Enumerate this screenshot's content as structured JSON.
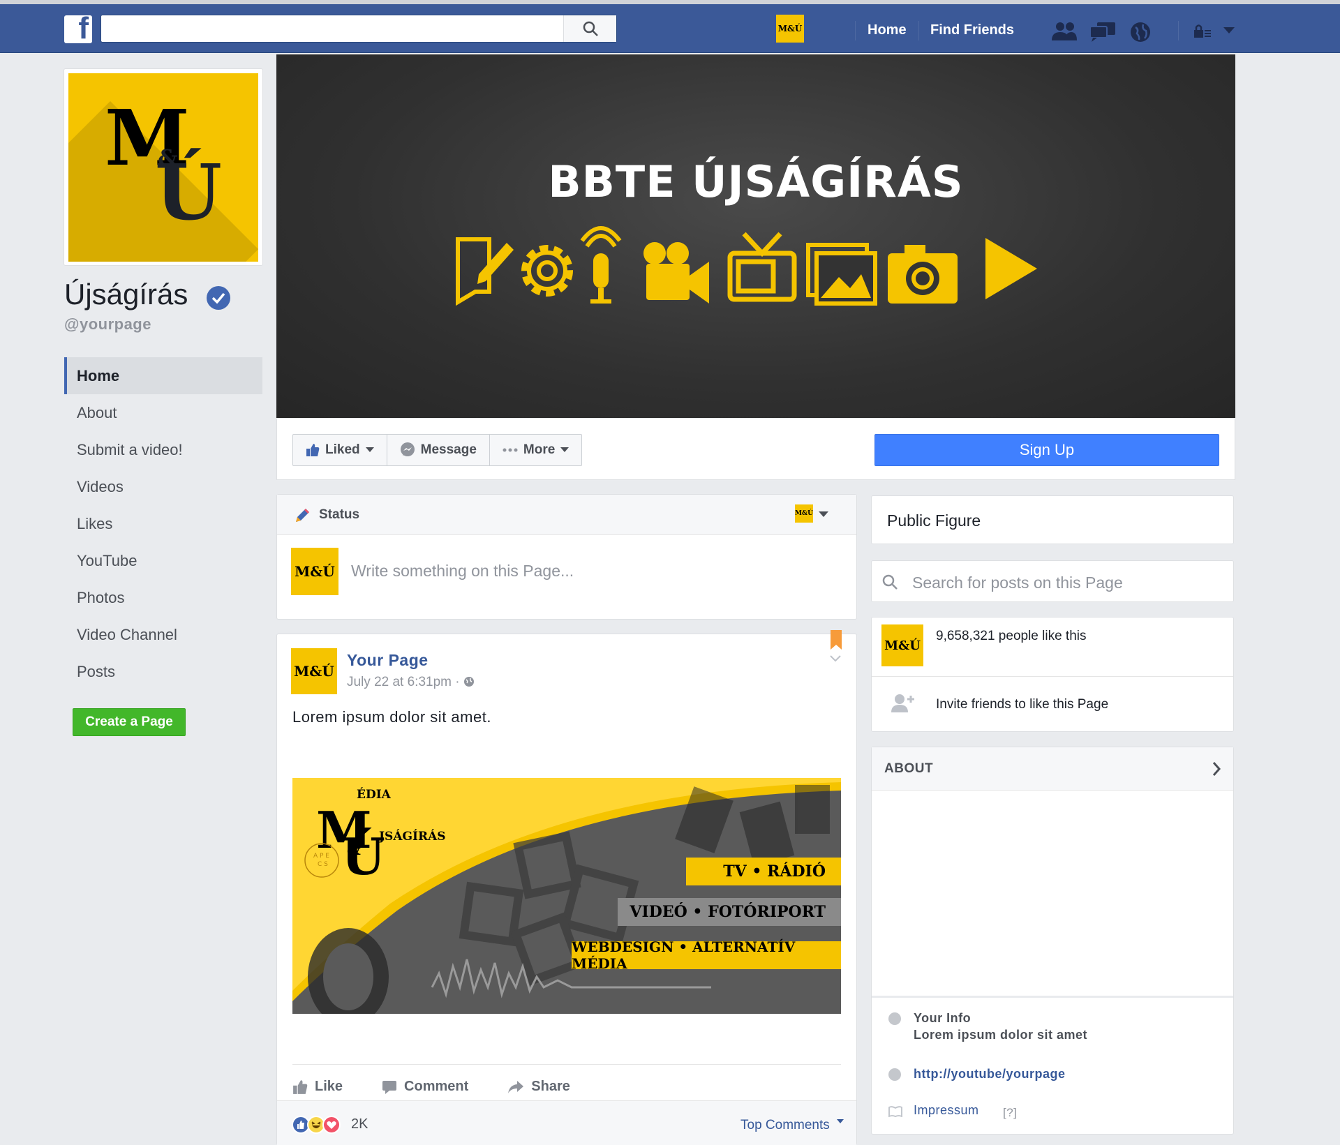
{
  "topbar": {
    "search_placeholder": "",
    "nav_home": "Home",
    "nav_find_friends": "Find Friends",
    "logo_letter": "f",
    "mini_logo_text": "M&Ú"
  },
  "left": {
    "page_name": "Újságírás",
    "handle": "@yourpage",
    "nav_items": [
      {
        "label": "Home",
        "active": true
      },
      {
        "label": "About"
      },
      {
        "label": "Submit a video!"
      },
      {
        "label": "Videos"
      },
      {
        "label": "Likes"
      },
      {
        "label": "YouTube"
      },
      {
        "label": "Photos"
      },
      {
        "label": "Video Channel"
      },
      {
        "label": "Posts"
      }
    ],
    "create_page_label": "Create a Page"
  },
  "cover": {
    "title": "BBTE ÚJSÁGÍRÁS",
    "icon_names": [
      "document-pencil-icon",
      "gear-icon",
      "microphone-icon",
      "video-camera-icon",
      "tv-icon",
      "gallery-icon",
      "photo-camera-icon",
      "play-icon"
    ],
    "accent": "#f5c400"
  },
  "actions": {
    "liked": "Liked",
    "message": "Message",
    "more": "More",
    "signup": "Sign Up"
  },
  "composer": {
    "tab_label": "Status",
    "placeholder": "Write something on this Page..."
  },
  "post": {
    "author": "Your Page",
    "time": "July 22 at 6:31pm",
    "body": "Lorem ipsum dolor sit amet.",
    "banner": {
      "media": "ÉDIA",
      "ujsagiras": "JSÁGÍRÁS",
      "line1": "TV • RÁDIÓ",
      "line2": "VIDEÓ • FOTÓRIPORT",
      "line3": "WEBDESIGN • ALTERNATÍV MÉDIA"
    },
    "like": "Like",
    "comment": "Comment",
    "share": "Share",
    "reactions_count": "2K",
    "top_comments": "Top Comments"
  },
  "right": {
    "category": "Public Figure",
    "search_placeholder": "Search for posts on this Page",
    "likes_count": "9,658,321 people like this",
    "invite": "Invite friends to like this Page",
    "about_header": "ABOUT",
    "your_info_label": "Your Info",
    "your_info_text": "Lorem ipsum dolor sit amet",
    "link": "http://youtube/yourpage",
    "impressum": "Impressum",
    "impressum_help": "[?]"
  },
  "colors": {
    "fb_blue": "#3b5998",
    "signup_blue": "#4080ff",
    "create_green": "#42b72a",
    "link_blue": "#365899"
  }
}
